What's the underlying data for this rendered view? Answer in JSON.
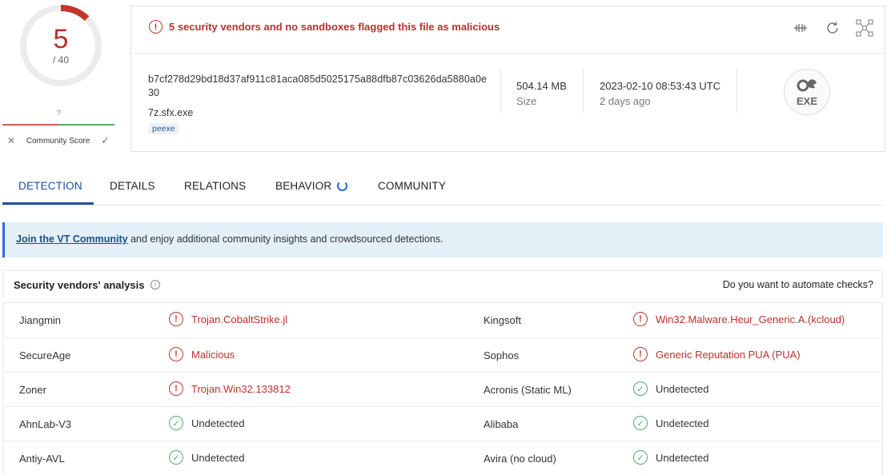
{
  "score": {
    "detected": "5",
    "total": "/ 40",
    "community_value": "?",
    "community_label": "Community Score"
  },
  "alert": {
    "text": "5 security vendors and no sandboxes flagged this file as malicious"
  },
  "file": {
    "hash": "b7cf278d29bd18d37af911c81aca085d5025175a88dfb87c03626da5880a0e30",
    "name": "7z.sfx.exe",
    "tag": "peexe",
    "size_value": "504.14 MB",
    "size_label": "Size",
    "date_value": "2023-02-10 08:53:43 UTC",
    "date_label": "2 days ago",
    "type_icon_text": "EXE"
  },
  "tabs": [
    {
      "label": "DETECTION",
      "active": true
    },
    {
      "label": "DETAILS"
    },
    {
      "label": "RELATIONS"
    },
    {
      "label": "BEHAVIOR"
    },
    {
      "label": "COMMUNITY"
    }
  ],
  "banner": {
    "link": "Join the VT Community",
    "text": " and enjoy additional community insights and crowdsourced detections."
  },
  "section": {
    "title": "Security vendors' analysis",
    "automate": "Do you want to automate checks?"
  },
  "vendors": [
    {
      "v1": "Jiangmin",
      "r1": "Trojan.CobaltStrike.jl",
      "s1": "bad",
      "v2": "Kingsoft",
      "r2": "Win32.Malware.Heur_Generic.A.(kcloud)",
      "s2": "bad"
    },
    {
      "v1": "SecureAge",
      "r1": "Malicious",
      "s1": "bad",
      "v2": "Sophos",
      "r2": "Generic Reputation PUA (PUA)",
      "s2": "bad"
    },
    {
      "v1": "Zoner",
      "r1": "Trojan.Win32.133812",
      "s1": "bad",
      "v2": "Acronis (Static ML)",
      "r2": "Undetected",
      "s2": "good"
    },
    {
      "v1": "AhnLab-V3",
      "r1": "Undetected",
      "s1": "good",
      "v2": "Alibaba",
      "r2": "Undetected",
      "s2": "good"
    },
    {
      "v1": "Antiy-AVL",
      "r1": "Undetected",
      "s1": "good",
      "v2": "Avira (no cloud)",
      "r2": "Undetected",
      "s2": "good"
    }
  ],
  "colors": {
    "accent": "#1f4fa0",
    "danger": "#b8312f",
    "ok": "#4caf6a",
    "banner_bg": "#e3f0f8"
  },
  "icons": {
    "alert": "alert-circle-icon",
    "ok": "check-circle-icon",
    "tools": [
      "compare-icon",
      "refresh-icon",
      "graph-icon"
    ]
  }
}
